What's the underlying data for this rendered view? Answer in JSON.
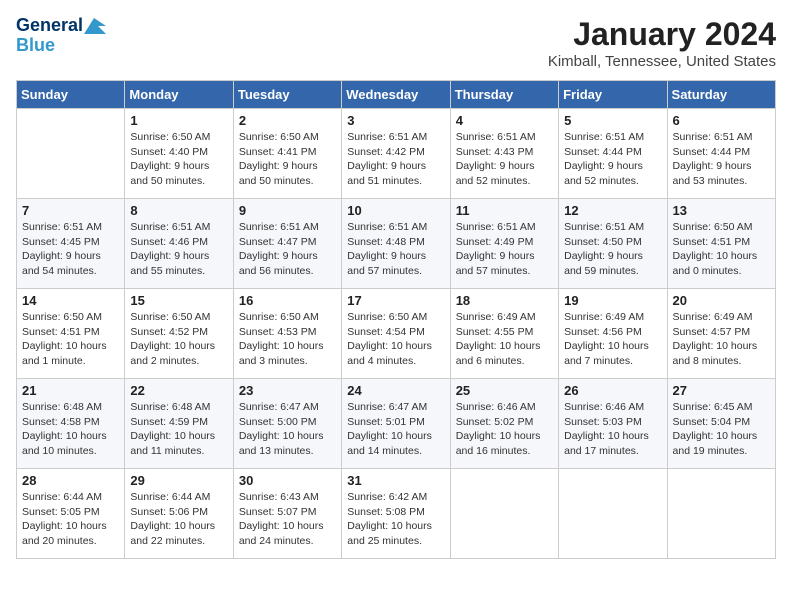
{
  "header": {
    "logo_line1": "General",
    "logo_line2": "Blue",
    "title": "January 2024",
    "subtitle": "Kimball, Tennessee, United States"
  },
  "days_of_week": [
    "Sunday",
    "Monday",
    "Tuesday",
    "Wednesday",
    "Thursday",
    "Friday",
    "Saturday"
  ],
  "weeks": [
    [
      {
        "day": "",
        "info": ""
      },
      {
        "day": "1",
        "info": "Sunrise: 6:50 AM\nSunset: 4:40 PM\nDaylight: 9 hours\nand 50 minutes."
      },
      {
        "day": "2",
        "info": "Sunrise: 6:50 AM\nSunset: 4:41 PM\nDaylight: 9 hours\nand 50 minutes."
      },
      {
        "day": "3",
        "info": "Sunrise: 6:51 AM\nSunset: 4:42 PM\nDaylight: 9 hours\nand 51 minutes."
      },
      {
        "day": "4",
        "info": "Sunrise: 6:51 AM\nSunset: 4:43 PM\nDaylight: 9 hours\nand 52 minutes."
      },
      {
        "day": "5",
        "info": "Sunrise: 6:51 AM\nSunset: 4:44 PM\nDaylight: 9 hours\nand 52 minutes."
      },
      {
        "day": "6",
        "info": "Sunrise: 6:51 AM\nSunset: 4:44 PM\nDaylight: 9 hours\nand 53 minutes."
      }
    ],
    [
      {
        "day": "7",
        "info": "Sunrise: 6:51 AM\nSunset: 4:45 PM\nDaylight: 9 hours\nand 54 minutes."
      },
      {
        "day": "8",
        "info": "Sunrise: 6:51 AM\nSunset: 4:46 PM\nDaylight: 9 hours\nand 55 minutes."
      },
      {
        "day": "9",
        "info": "Sunrise: 6:51 AM\nSunset: 4:47 PM\nDaylight: 9 hours\nand 56 minutes."
      },
      {
        "day": "10",
        "info": "Sunrise: 6:51 AM\nSunset: 4:48 PM\nDaylight: 9 hours\nand 57 minutes."
      },
      {
        "day": "11",
        "info": "Sunrise: 6:51 AM\nSunset: 4:49 PM\nDaylight: 9 hours\nand 57 minutes."
      },
      {
        "day": "12",
        "info": "Sunrise: 6:51 AM\nSunset: 4:50 PM\nDaylight: 9 hours\nand 59 minutes."
      },
      {
        "day": "13",
        "info": "Sunrise: 6:50 AM\nSunset: 4:51 PM\nDaylight: 10 hours\nand 0 minutes."
      }
    ],
    [
      {
        "day": "14",
        "info": "Sunrise: 6:50 AM\nSunset: 4:51 PM\nDaylight: 10 hours\nand 1 minute."
      },
      {
        "day": "15",
        "info": "Sunrise: 6:50 AM\nSunset: 4:52 PM\nDaylight: 10 hours\nand 2 minutes."
      },
      {
        "day": "16",
        "info": "Sunrise: 6:50 AM\nSunset: 4:53 PM\nDaylight: 10 hours\nand 3 minutes."
      },
      {
        "day": "17",
        "info": "Sunrise: 6:50 AM\nSunset: 4:54 PM\nDaylight: 10 hours\nand 4 minutes."
      },
      {
        "day": "18",
        "info": "Sunrise: 6:49 AM\nSunset: 4:55 PM\nDaylight: 10 hours\nand 6 minutes."
      },
      {
        "day": "19",
        "info": "Sunrise: 6:49 AM\nSunset: 4:56 PM\nDaylight: 10 hours\nand 7 minutes."
      },
      {
        "day": "20",
        "info": "Sunrise: 6:49 AM\nSunset: 4:57 PM\nDaylight: 10 hours\nand 8 minutes."
      }
    ],
    [
      {
        "day": "21",
        "info": "Sunrise: 6:48 AM\nSunset: 4:58 PM\nDaylight: 10 hours\nand 10 minutes."
      },
      {
        "day": "22",
        "info": "Sunrise: 6:48 AM\nSunset: 4:59 PM\nDaylight: 10 hours\nand 11 minutes."
      },
      {
        "day": "23",
        "info": "Sunrise: 6:47 AM\nSunset: 5:00 PM\nDaylight: 10 hours\nand 13 minutes."
      },
      {
        "day": "24",
        "info": "Sunrise: 6:47 AM\nSunset: 5:01 PM\nDaylight: 10 hours\nand 14 minutes."
      },
      {
        "day": "25",
        "info": "Sunrise: 6:46 AM\nSunset: 5:02 PM\nDaylight: 10 hours\nand 16 minutes."
      },
      {
        "day": "26",
        "info": "Sunrise: 6:46 AM\nSunset: 5:03 PM\nDaylight: 10 hours\nand 17 minutes."
      },
      {
        "day": "27",
        "info": "Sunrise: 6:45 AM\nSunset: 5:04 PM\nDaylight: 10 hours\nand 19 minutes."
      }
    ],
    [
      {
        "day": "28",
        "info": "Sunrise: 6:44 AM\nSunset: 5:05 PM\nDaylight: 10 hours\nand 20 minutes."
      },
      {
        "day": "29",
        "info": "Sunrise: 6:44 AM\nSunset: 5:06 PM\nDaylight: 10 hours\nand 22 minutes."
      },
      {
        "day": "30",
        "info": "Sunrise: 6:43 AM\nSunset: 5:07 PM\nDaylight: 10 hours\nand 24 minutes."
      },
      {
        "day": "31",
        "info": "Sunrise: 6:42 AM\nSunset: 5:08 PM\nDaylight: 10 hours\nand 25 minutes."
      },
      {
        "day": "",
        "info": ""
      },
      {
        "day": "",
        "info": ""
      },
      {
        "day": "",
        "info": ""
      }
    ]
  ]
}
